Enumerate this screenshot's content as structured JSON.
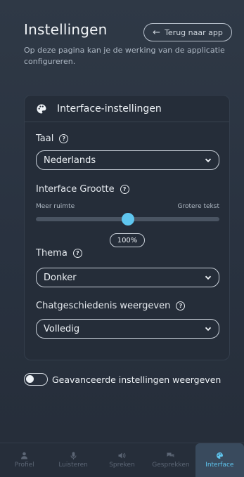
{
  "header": {
    "title": "Instellingen",
    "back_label": "Terug naar app",
    "description": "Op deze pagina kan je de werking van de applicatie configureren."
  },
  "card": {
    "title": "Interface-instellingen",
    "icon": "palette-icon",
    "language": {
      "label": "Taal",
      "value": "Nederlands"
    },
    "size": {
      "label": "Interface Grootte",
      "min_label": "Meer ruimte",
      "max_label": "Grotere tekst",
      "value_label": "100%",
      "value_fraction": 0.5
    },
    "theme": {
      "label": "Thema",
      "value": "Donker"
    },
    "history": {
      "label": "Chatgeschiedenis weergeven",
      "value": "Volledig"
    }
  },
  "advanced": {
    "label": "Geavanceerde instellingen weergeven",
    "enabled": false
  },
  "nav": {
    "items": [
      {
        "label": "Profiel",
        "icon": "person-icon"
      },
      {
        "label": "Luisteren",
        "icon": "microphone-icon"
      },
      {
        "label": "Spreken",
        "icon": "speaker-icon"
      },
      {
        "label": "Gesprekken",
        "icon": "chat-icon"
      },
      {
        "label": "Interface",
        "icon": "palette-icon",
        "active": true
      }
    ]
  },
  "colors": {
    "accent": "#5fc6ef",
    "background": "#2b3440",
    "card": "#252d39"
  }
}
